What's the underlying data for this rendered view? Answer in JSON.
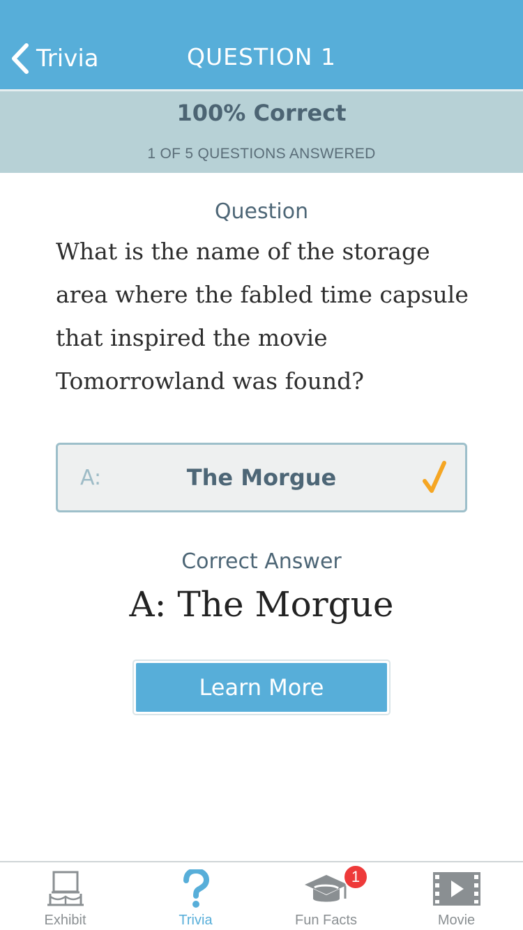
{
  "nav": {
    "back_label": "Trivia",
    "title": "QUESTION 1"
  },
  "score": {
    "percent_label": "100% Correct",
    "answered_label": "1 OF 5 QUESTIONS ANSWERED"
  },
  "question": {
    "heading": "Question",
    "text": "What is the name of the storage area where the fabled time capsule that inspired the movie Tomorrowland was found?"
  },
  "answer_option": {
    "letter": "A:",
    "text": "The Morgue",
    "status_icon": "checkmark-icon",
    "check_color": "#f5a623"
  },
  "correct_answer": {
    "heading": "Correct Answer",
    "text": "A: The Morgue"
  },
  "learn_more_label": "Learn More",
  "tabs": [
    {
      "label": "Exhibit",
      "icon": "exhibit-icon",
      "active": false
    },
    {
      "label": "Trivia",
      "icon": "question-mark-icon",
      "active": true
    },
    {
      "label": "Fun Facts",
      "icon": "graduation-cap-icon",
      "active": false
    },
    {
      "label": "Movie",
      "icon": "film-play-icon",
      "active": false
    }
  ],
  "fun_facts_badge": "1",
  "colors": {
    "accent": "#57aed9",
    "banner": "#b7d1d6",
    "badge": "#ee3a3a"
  }
}
